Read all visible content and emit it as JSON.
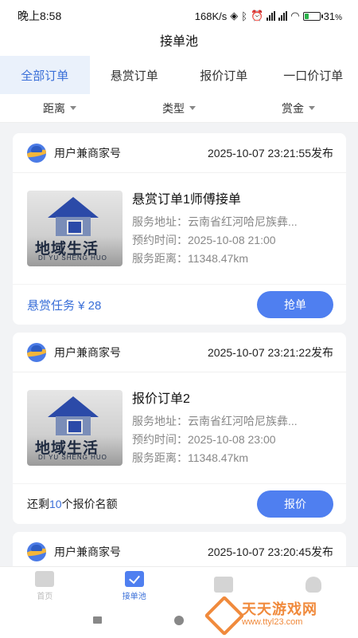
{
  "status_bar": {
    "time": "晚上8:58",
    "network_speed": "168K/s",
    "icons": [
      "nfc-icon",
      "bluetooth-icon",
      "alarm-icon",
      "signal-icon",
      "signal-icon",
      "wifi-icon",
      "battery-icon"
    ],
    "battery_percent": "31",
    "battery_fraction": 0.31,
    "battery_color": "#2ab24a"
  },
  "page": {
    "title": "接单池"
  },
  "tabs": [
    {
      "label": "全部订单",
      "active": true
    },
    {
      "label": "悬赏订单",
      "active": false
    },
    {
      "label": "报价订单",
      "active": false
    },
    {
      "label": "一口价订单",
      "active": false
    }
  ],
  "filters": [
    {
      "label": "距离"
    },
    {
      "label": "类型"
    },
    {
      "label": "赏金"
    }
  ],
  "orders": [
    {
      "user": "用户兼商家号",
      "time": "2025-10-07 23:21:55发布",
      "title": "悬赏订单1师傅接单",
      "address_label": "服务地址：",
      "address": "云南省红河哈尼族彝...",
      "appointment_label": "预约时间：",
      "appointment": "2025-10-08 21:00",
      "distance_label": "服务距离：",
      "distance": "11348.47km",
      "thumb_cn": "地域生活",
      "thumb_en": "DI YU SHENG HUO",
      "reward": "悬赏任务 ¥ 28",
      "button": "抢单"
    },
    {
      "user": "用户兼商家号",
      "time": "2025-10-07 23:21:22发布",
      "title": "报价订单2",
      "address_label": "服务地址：",
      "address": "云南省红河哈尼族彝...",
      "appointment_label": "预约时间：",
      "appointment": "2025-10-08 23:00",
      "distance_label": "服务距离：",
      "distance": "11348.47km",
      "thumb_cn": "地域生活",
      "thumb_en": "DI YU SHENG HUO",
      "quota_prefix": "还剩",
      "quota_count": "10",
      "quota_suffix": "个报价名额",
      "button": "报价"
    },
    {
      "user": "用户兼商家号",
      "time": "2025-10-07 23:20:45发布"
    }
  ],
  "bottom_nav": [
    {
      "label": "首页",
      "icon": "home-store-icon",
      "active": false
    },
    {
      "label": "接单池",
      "icon": "order-pool-check-icon",
      "active": true
    },
    {
      "label": "",
      "icon": "wallet-icon",
      "active": false
    },
    {
      "label": "",
      "icon": "user-icon",
      "active": false
    }
  ],
  "watermark": {
    "title": "天天游戏网",
    "url": "www.ttyl23.com"
  },
  "colors": {
    "accent": "#4f7ff0",
    "accent_text": "#3a6fd8",
    "tab_active_bg": "#eaf1fb",
    "watermark": "#f08a3c"
  }
}
